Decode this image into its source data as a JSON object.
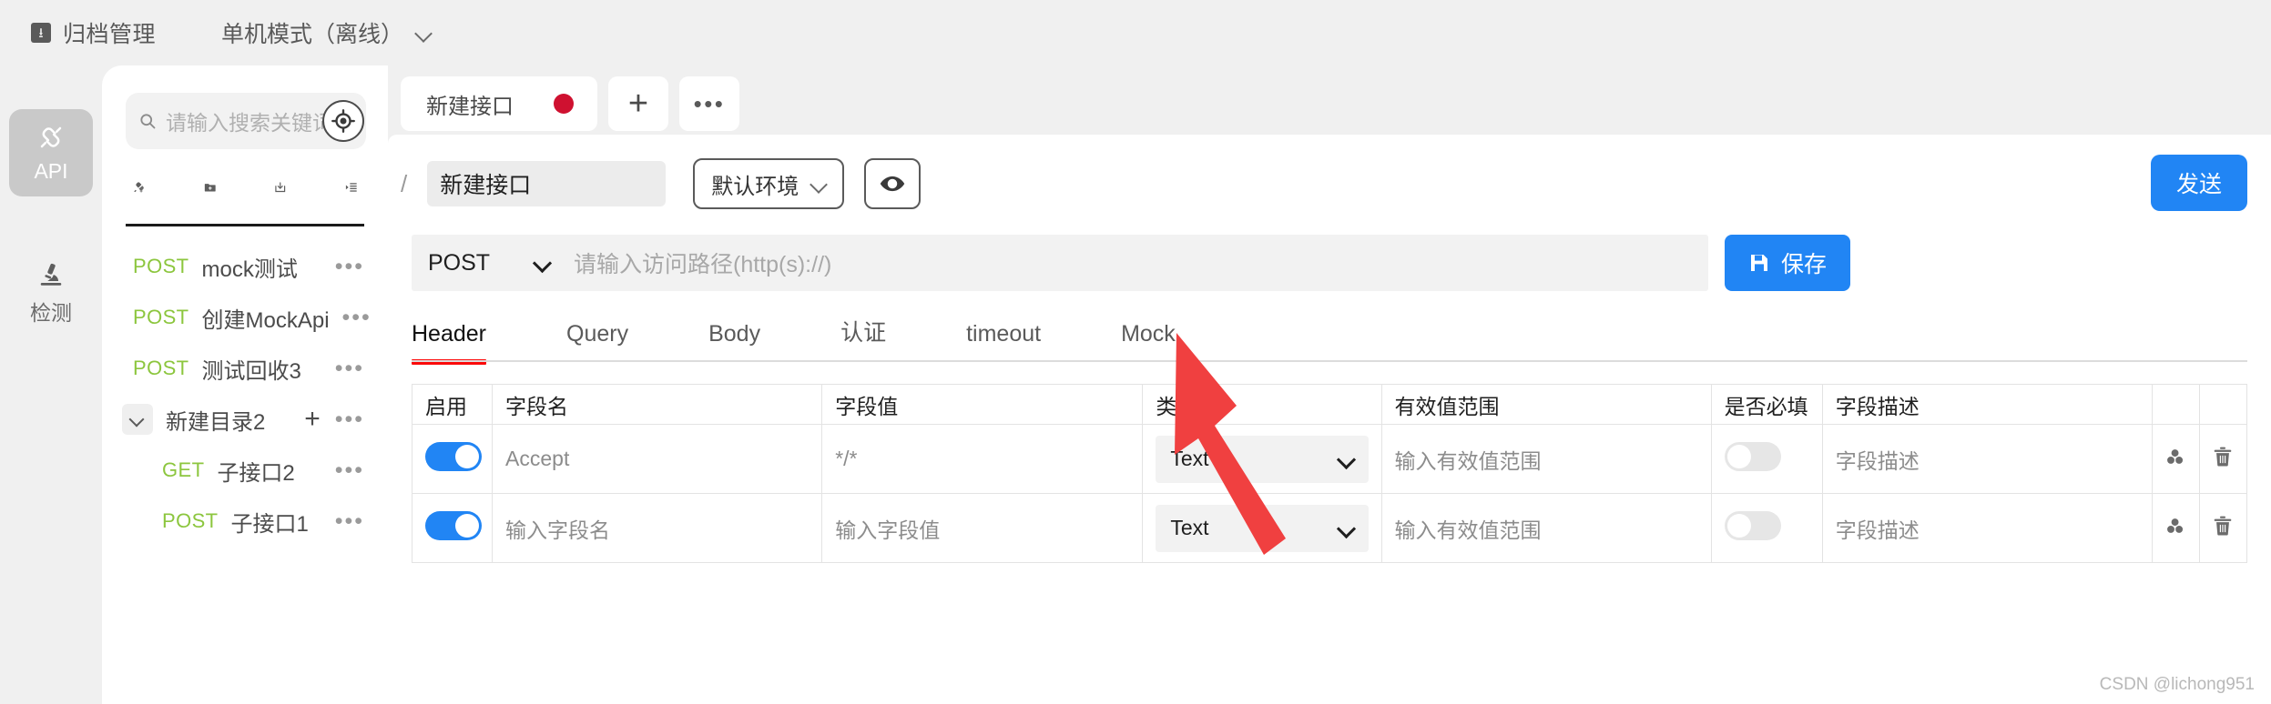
{
  "topbar": {
    "archive_icon": "download-box-icon",
    "archive_label": "归档管理",
    "mode_label": "单机模式（离线）",
    "mode_chevron_icon": "chevron-down-icon"
  },
  "rail": {
    "items": [
      {
        "label": "API",
        "icon": "plug-connector-icon",
        "active": true
      },
      {
        "label": "检测",
        "icon": "microscope-icon",
        "active": false
      }
    ]
  },
  "sidebar": {
    "search": {
      "icon": "search-icon",
      "placeholder": "请输入搜索关键词",
      "value": ""
    },
    "locate_button_icon": "target-crosshair-icon",
    "toolbar": [
      {
        "name": "add-api",
        "icon": "plug-plus-icon"
      },
      {
        "name": "add-folder",
        "icon": "folder-plus-icon"
      },
      {
        "name": "import",
        "icon": "import-download-icon"
      },
      {
        "name": "collapse-all",
        "icon": "list-indent-icon"
      }
    ],
    "tree": [
      {
        "type": "api",
        "method": "POST",
        "name": "mock测试",
        "more": "•••"
      },
      {
        "type": "api",
        "method": "POST",
        "name": "创建MockApi",
        "more": "•••"
      },
      {
        "type": "api",
        "method": "POST",
        "name": "测试回收3",
        "more": "•••"
      },
      {
        "type": "folder",
        "name": "新建目录2",
        "expanded": true,
        "chevron_icon": "chevron-down-icon",
        "add": "+",
        "more": "•••"
      },
      {
        "type": "api",
        "method": "GET",
        "name": "子接口2",
        "more": "•••",
        "child": true
      },
      {
        "type": "api",
        "method": "POST",
        "name": "子接口1",
        "more": "•••",
        "child": true
      }
    ],
    "method_color": "#8cc63e"
  },
  "main": {
    "doc_tabs": [
      {
        "label": "新建接口",
        "unsaved": true,
        "unsaved_color": "#cf1130"
      }
    ],
    "new_tab_button": "+",
    "tab_more_button": "•••",
    "breadcrumb_slash": "/",
    "api_name": "新建接口",
    "env_select": {
      "label": "默认环境",
      "chevron_icon": "chevron-down-icon"
    },
    "preview_button_icon": "eye-icon",
    "send_button": "发送",
    "request": {
      "method": "POST",
      "method_chevron_icon": "chevron-down-icon",
      "url_placeholder": "请输入访问路径(http(s)://)",
      "url_value": "",
      "save_button": "保存",
      "save_icon": "floppy-save-icon"
    },
    "tabs": [
      {
        "label": "Header",
        "active": true
      },
      {
        "label": "Query",
        "active": false
      },
      {
        "label": "Body",
        "active": false
      },
      {
        "label": "认证",
        "active": false
      },
      {
        "label": "timeout",
        "active": false
      },
      {
        "label": "Mock",
        "active": false
      }
    ],
    "active_tab_indicator_color": "#fa0a0a",
    "accent_color": "#2185f4",
    "table": {
      "columns": [
        "启用",
        "字段名",
        "字段值",
        "类型",
        "有效值范围",
        "是否必填",
        "字段描述",
        "",
        ""
      ],
      "rows": [
        {
          "enabled": true,
          "field_name": "Accept",
          "field_name_is_placeholder": false,
          "field_value": "*/*",
          "field_value_is_placeholder": false,
          "type": "Text",
          "value_range": "输入有效值范围",
          "required": false,
          "description": "字段描述",
          "actions": [
            "link-chain-icon",
            "trash-icon"
          ]
        },
        {
          "enabled": true,
          "field_name": "输入字段名",
          "field_name_is_placeholder": true,
          "field_value": "输入字段值",
          "field_value_is_placeholder": true,
          "type": "Text",
          "value_range": "输入有效值范围",
          "required": false,
          "description": "字段描述",
          "actions": [
            "link-chain-icon",
            "trash-icon"
          ]
        }
      ]
    }
  },
  "watermark": "CSDN @lichong951"
}
